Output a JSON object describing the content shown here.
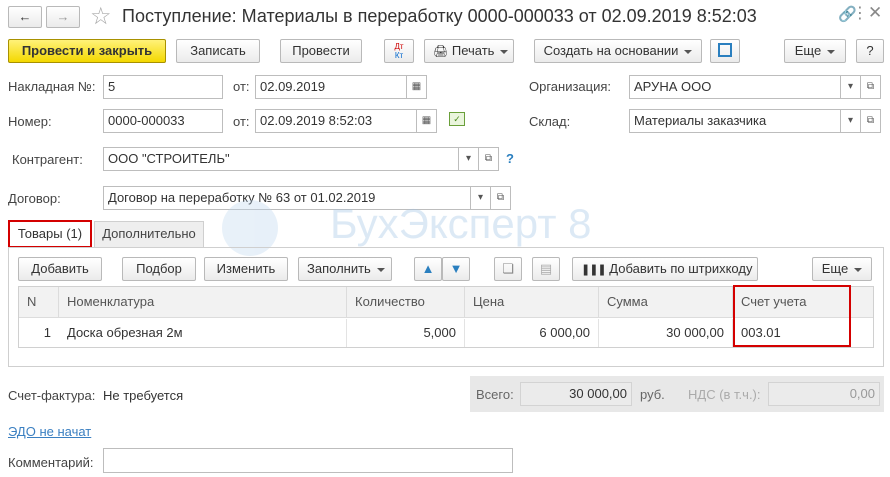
{
  "header": {
    "title": "Поступление: Материалы в переработку 0000-000033 от 02.09.2019 8:52:03"
  },
  "toolbar": {
    "post_close": "Провести и закрыть",
    "save": "Записать",
    "post": "Провести",
    "print": "Печать",
    "create_based": "Создать на основании",
    "more": "Еще",
    "help": "?"
  },
  "form": {
    "invoice_label": "Накладная  №:",
    "invoice_no": "5",
    "from_label": "от:",
    "invoice_date": "02.09.2019",
    "org_label": "Организация:",
    "org": "АРУНА ООО",
    "number_label": "Номер:",
    "number": "0000-000033",
    "from_label2": "от:",
    "number_date": "02.09.2019  8:52:03",
    "warehouse_label": "Склад:",
    "warehouse": "Материалы заказчика",
    "counterparty_label": "Контрагент:",
    "counterparty": "ООО \"СТРОИТЕЛЬ\"",
    "contract_label": "Договор:",
    "contract": "Договор на переработку № 63 от 01.02.2019"
  },
  "tabs": [
    {
      "label": "Товары (1)"
    },
    {
      "label": "Дополнительно"
    }
  ],
  "table_toolbar": {
    "add": "Добавить",
    "select": "Подбор",
    "change": "Изменить",
    "fill": "Заполнить",
    "barcode": "Добавить по штрихкоду",
    "more": "Еще"
  },
  "table": {
    "columns": [
      "N",
      "Номенклатура",
      "Количество",
      "Цена",
      "Сумма",
      "Счет учета"
    ],
    "rows": [
      {
        "n": "1",
        "item": "Доска обрезная 2м",
        "qty": "5,000",
        "price": "6 000,00",
        "sum": "30 000,00",
        "account": "003.01"
      }
    ]
  },
  "footer": {
    "invoice_label": "Счет-фактура:",
    "invoice_value": "Не требуется",
    "total_label": "Всего:",
    "total_value": "30 000,00",
    "currency": "руб.",
    "vat_label": "НДС (в т.ч.):",
    "vat_value": "0,00",
    "edo_link": "ЭДО не начат",
    "comment_label": "Комментарий:",
    "comment_value": ""
  },
  "watermark": "БухЭксперт 8",
  "colors": {
    "highlight_red": "#d40000",
    "primary_yellow": "#f4d800",
    "link_blue": "#3a7fc1"
  }
}
